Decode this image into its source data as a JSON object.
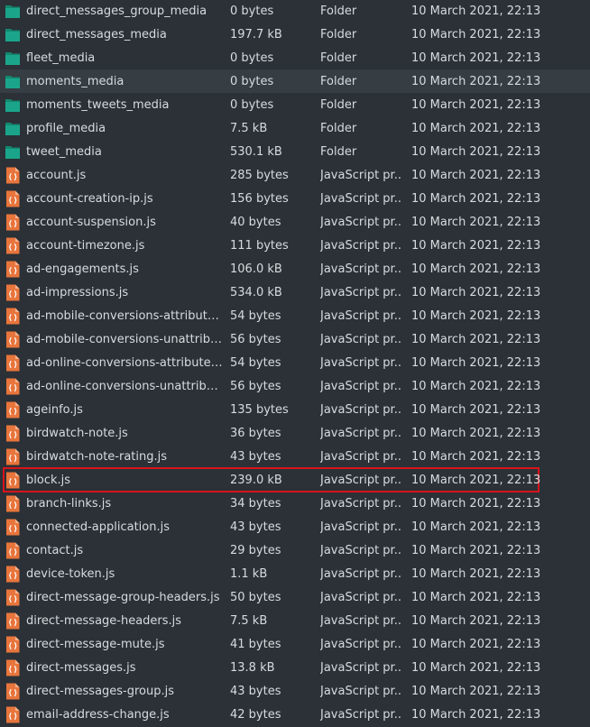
{
  "colors": {
    "background": "#2b3136",
    "text": "#d6dbdf",
    "folder_icon": "#1aa58b",
    "js_icon": "#e8753c",
    "highlight_border": "#d8141b"
  },
  "files": [
    {
      "name": "direct_messages_group_media",
      "size": "0 bytes",
      "type": "Folder",
      "modified": "10 March 2021, 22:13",
      "icon": "folder-icon"
    },
    {
      "name": "direct_messages_media",
      "size": "197.7 kB",
      "type": "Folder",
      "modified": "10 March 2021, 22:13",
      "icon": "folder-icon"
    },
    {
      "name": "fleet_media",
      "size": "0 bytes",
      "type": "Folder",
      "modified": "10 March 2021, 22:13",
      "icon": "folder-icon"
    },
    {
      "name": "moments_media",
      "size": "0 bytes",
      "type": "Folder",
      "modified": "10 March 2021, 22:13",
      "icon": "folder-icon"
    },
    {
      "name": "moments_tweets_media",
      "size": "0 bytes",
      "type": "Folder",
      "modified": "10 March 2021, 22:13",
      "icon": "folder-icon"
    },
    {
      "name": "profile_media",
      "size": "7.5 kB",
      "type": "Folder",
      "modified": "10 March 2021, 22:13",
      "icon": "folder-icon"
    },
    {
      "name": "tweet_media",
      "size": "530.1 kB",
      "type": "Folder",
      "modified": "10 March 2021, 22:13",
      "icon": "folder-icon"
    },
    {
      "name": "account.js",
      "size": "285 bytes",
      "type": "JavaScript pr...",
      "modified": "10 March 2021, 22:13",
      "icon": "javascript-file-icon"
    },
    {
      "name": "account-creation-ip.js",
      "size": "156 bytes",
      "type": "JavaScript pr...",
      "modified": "10 March 2021, 22:13",
      "icon": "javascript-file-icon"
    },
    {
      "name": "account-suspension.js",
      "size": "40 bytes",
      "type": "JavaScript pr...",
      "modified": "10 March 2021, 22:13",
      "icon": "javascript-file-icon"
    },
    {
      "name": "account-timezone.js",
      "size": "111 bytes",
      "type": "JavaScript pr...",
      "modified": "10 March 2021, 22:13",
      "icon": "javascript-file-icon"
    },
    {
      "name": "ad-engagements.js",
      "size": "106.0 kB",
      "type": "JavaScript pr...",
      "modified": "10 March 2021, 22:13",
      "icon": "javascript-file-icon"
    },
    {
      "name": "ad-impressions.js",
      "size": "534.0 kB",
      "type": "JavaScript pr...",
      "modified": "10 March 2021, 22:13",
      "icon": "javascript-file-icon"
    },
    {
      "name": "ad-mobile-conversions-attributed...",
      "size": "54 bytes",
      "type": "JavaScript pr...",
      "modified": "10 March 2021, 22:13",
      "icon": "javascript-file-icon"
    },
    {
      "name": "ad-mobile-conversions-unattribut...",
      "size": "56 bytes",
      "type": "JavaScript pr...",
      "modified": "10 March 2021, 22:13",
      "icon": "javascript-file-icon"
    },
    {
      "name": "ad-online-conversions-attributed.js",
      "size": "54 bytes",
      "type": "JavaScript pr...",
      "modified": "10 March 2021, 22:13",
      "icon": "javascript-file-icon"
    },
    {
      "name": "ad-online-conversions-unattribut...",
      "size": "56 bytes",
      "type": "JavaScript pr...",
      "modified": "10 March 2021, 22:13",
      "icon": "javascript-file-icon"
    },
    {
      "name": "ageinfo.js",
      "size": "135 bytes",
      "type": "JavaScript pr...",
      "modified": "10 March 2021, 22:13",
      "icon": "javascript-file-icon"
    },
    {
      "name": "birdwatch-note.js",
      "size": "36 bytes",
      "type": "JavaScript pr...",
      "modified": "10 March 2021, 22:13",
      "icon": "javascript-file-icon"
    },
    {
      "name": "birdwatch-note-rating.js",
      "size": "43 bytes",
      "type": "JavaScript pr...",
      "modified": "10 March 2021, 22:13",
      "icon": "javascript-file-icon"
    },
    {
      "name": "block.js",
      "size": "239.0 kB",
      "type": "JavaScript pr...",
      "modified": "10 March 2021, 22:13",
      "icon": "javascript-file-icon"
    },
    {
      "name": "branch-links.js",
      "size": "34 bytes",
      "type": "JavaScript pr...",
      "modified": "10 March 2021, 22:13",
      "icon": "javascript-file-icon"
    },
    {
      "name": "connected-application.js",
      "size": "43 bytes",
      "type": "JavaScript pr...",
      "modified": "10 March 2021, 22:13",
      "icon": "javascript-file-icon"
    },
    {
      "name": "contact.js",
      "size": "29 bytes",
      "type": "JavaScript pr...",
      "modified": "10 March 2021, 22:13",
      "icon": "javascript-file-icon"
    },
    {
      "name": "device-token.js",
      "size": "1.1 kB",
      "type": "JavaScript pr...",
      "modified": "10 March 2021, 22:13",
      "icon": "javascript-file-icon"
    },
    {
      "name": "direct-message-group-headers.js",
      "size": "50 bytes",
      "type": "JavaScript pr...",
      "modified": "10 March 2021, 22:13",
      "icon": "javascript-file-icon"
    },
    {
      "name": "direct-message-headers.js",
      "size": "7.5 kB",
      "type": "JavaScript pr...",
      "modified": "10 March 2021, 22:13",
      "icon": "javascript-file-icon"
    },
    {
      "name": "direct-message-mute.js",
      "size": "41 bytes",
      "type": "JavaScript pr...",
      "modified": "10 March 2021, 22:13",
      "icon": "javascript-file-icon"
    },
    {
      "name": "direct-messages.js",
      "size": "13.8 kB",
      "type": "JavaScript pr...",
      "modified": "10 March 2021, 22:13",
      "icon": "javascript-file-icon"
    },
    {
      "name": "direct-messages-group.js",
      "size": "43 bytes",
      "type": "JavaScript pr...",
      "modified": "10 March 2021, 22:13",
      "icon": "javascript-file-icon"
    },
    {
      "name": "email-address-change.js",
      "size": "42 bytes",
      "type": "JavaScript pr...",
      "modified": "10 March 2021, 22:13",
      "icon": "javascript-file-icon"
    }
  ]
}
